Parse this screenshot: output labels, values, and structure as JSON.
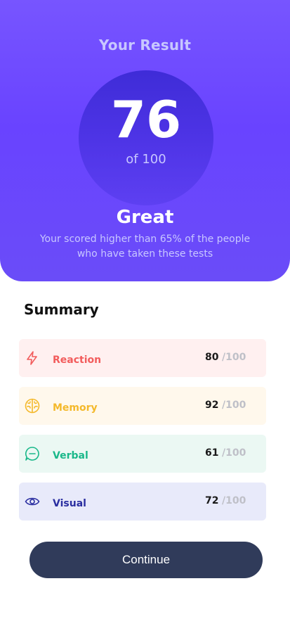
{
  "result": {
    "title": "Your Result",
    "score": "76",
    "score_max": "of 100",
    "rating": "Great",
    "description": "Your scored higher than 65% of the people who have taken these tests"
  },
  "summary": {
    "title": "Summary",
    "items": [
      {
        "label": "Reaction",
        "score": "80",
        "max": "/100",
        "icon": "lightning-icon",
        "color": "#f25c5c",
        "bg": "#fff0f0"
      },
      {
        "label": "Memory",
        "score": "92",
        "max": "/100",
        "icon": "brain-icon",
        "color": "#f4b92b",
        "bg": "#fff8ec"
      },
      {
        "label": "Verbal",
        "score": "61",
        "max": "/100",
        "icon": "speech-bubble-icon",
        "color": "#1ab88a",
        "bg": "#ebf8f3"
      },
      {
        "label": "Visual",
        "score": "72",
        "max": "/100",
        "icon": "eye-icon",
        "color": "#2a2ea0",
        "bg": "#e8eafa"
      }
    ]
  },
  "continue_label": "Continue",
  "colors": {
    "gradient_top": "#7755ff",
    "gradient_bottom": "#6a4cf8",
    "circle": "#3a29d4",
    "button": "#303b5a"
  }
}
